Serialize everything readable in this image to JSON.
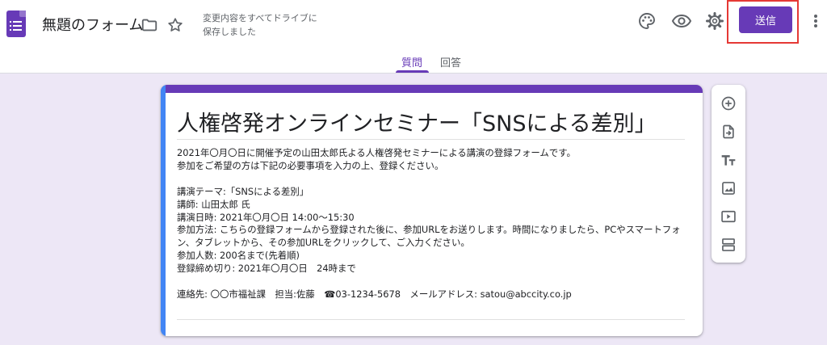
{
  "header": {
    "form_title": "無題のフォーム",
    "save_status": "変更内容をすべてドライブに保存しました",
    "send_label": "送信",
    "tabs": [
      {
        "label": "質問",
        "active": true
      },
      {
        "label": "回答",
        "active": false
      }
    ],
    "icons": [
      "forms-app-icon",
      "folder-icon",
      "star-icon",
      "palette-icon",
      "preview-eye-icon",
      "settings-gear-icon",
      "more-vert-icon"
    ]
  },
  "form": {
    "title": "人権啓発オンラインセミナー「SNSによる差別」",
    "description_lines": [
      "2021年〇月〇日に開催予定の山田太郎氏よる人権啓発セミナーによる講演の登録フォームです。",
      "参加をご希望の方は下記の必要事項を入力の上、登録ください。",
      "",
      "講演テーマ:「SNSによる差別」",
      "講師: 山田太郎 氏",
      "講演日時: 2021年〇月〇日 14:00～15:30",
      "参加方法: こちらの登録フォームから登録された後に、参加URLをお送りします。時間になりましたら、PCやスマートフォン、タブレットから、その参加URLをクリックして、ご入力ください。",
      "参加人数: 200名まで(先着順)",
      "登録締め切り: 2021年〇月〇日　24時まで",
      "",
      "連絡先: 〇〇市福祉課　担当:佐藤　☎03-1234-5678　メールアドレス: satou@abccity.co.jp"
    ]
  },
  "toolbar": {
    "icons": [
      "add-question-icon",
      "import-questions-icon",
      "add-title-icon",
      "add-image-icon",
      "add-video-icon",
      "add-section-icon"
    ]
  },
  "colors": {
    "accent": "#673ab7",
    "background": "#ede7f6",
    "card_left_strip": "#4285f4",
    "highlight_box": "#e53935"
  }
}
